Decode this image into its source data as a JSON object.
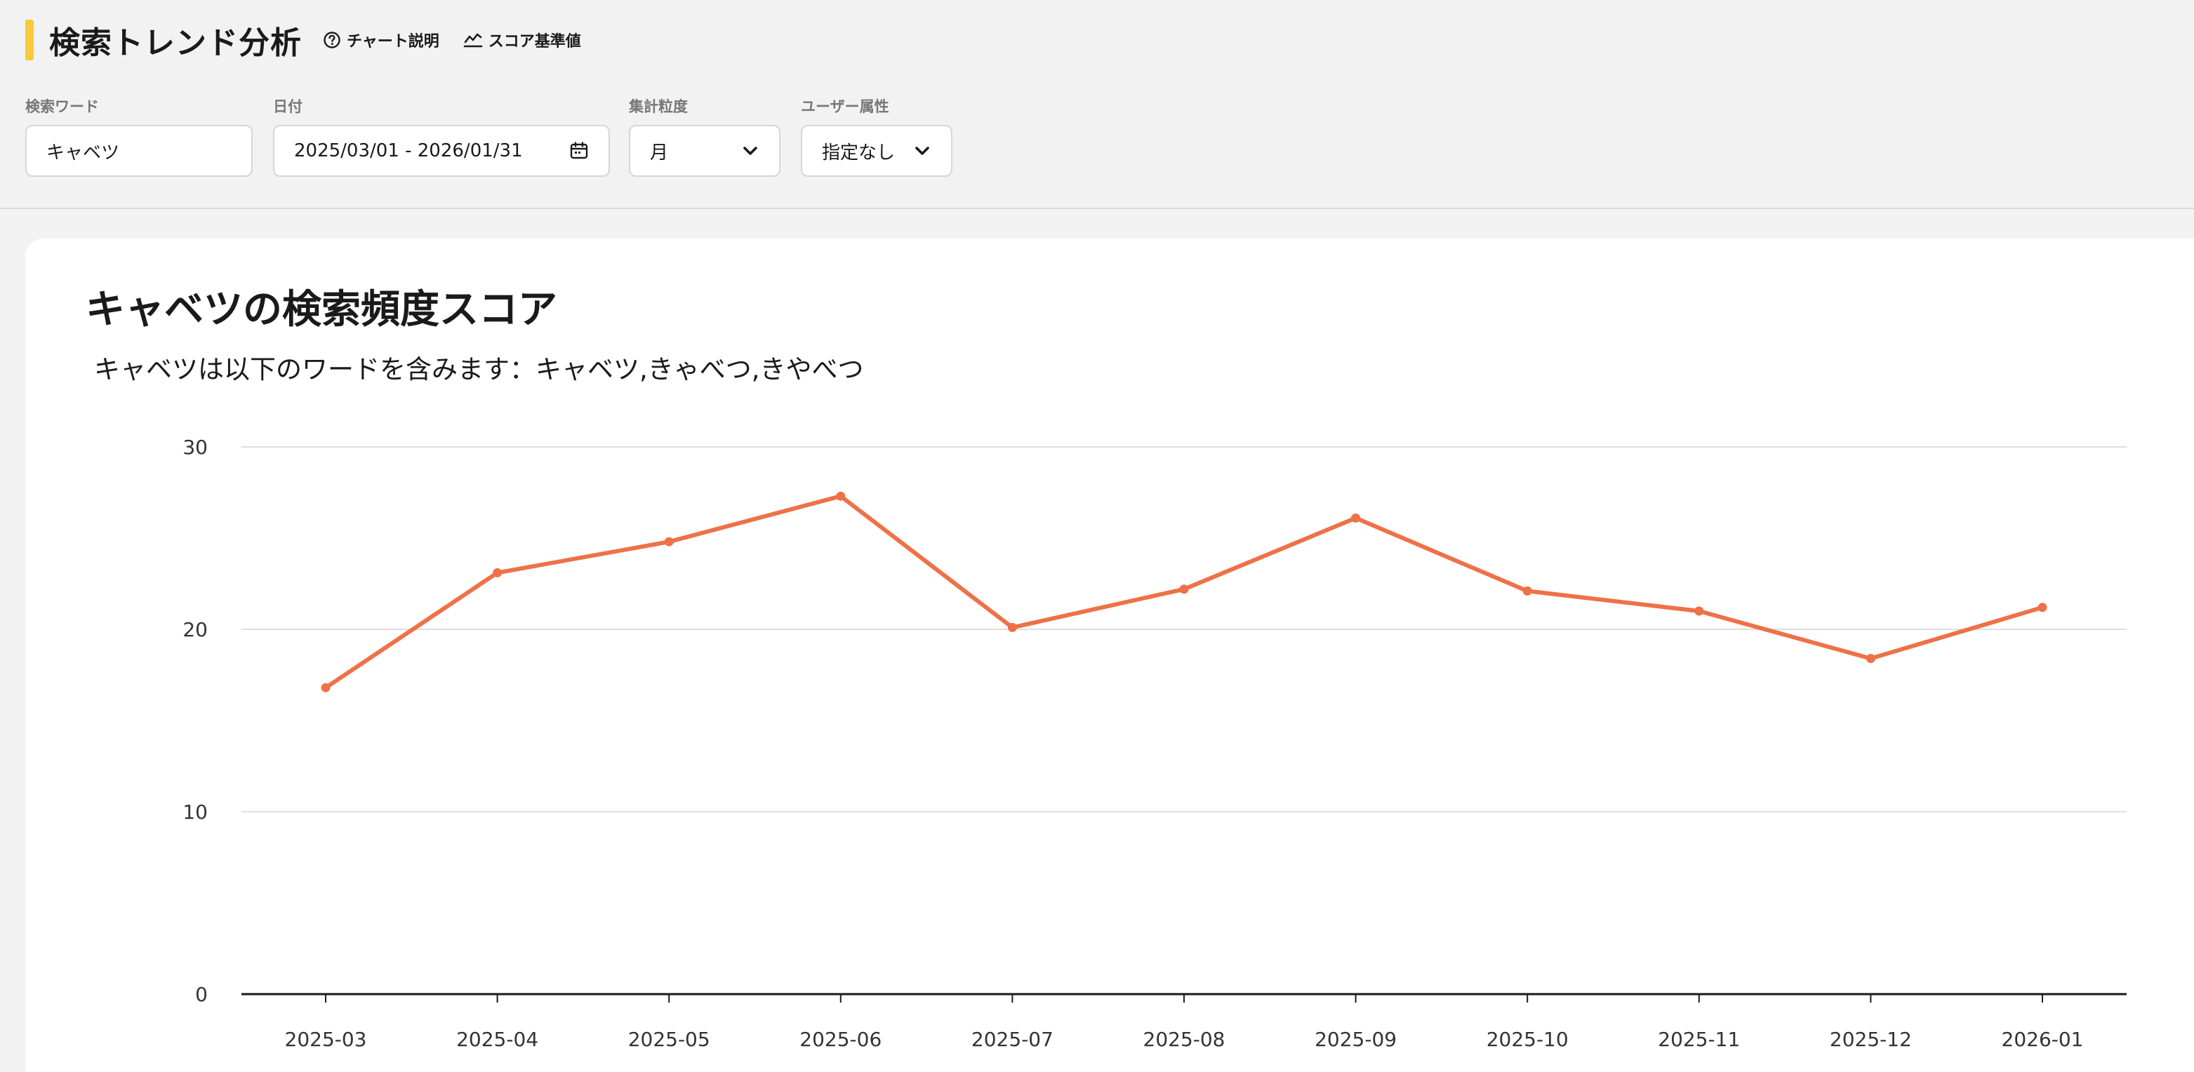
{
  "app": {
    "title": "検索トレンド分析",
    "links": [
      {
        "label": "チャート説明",
        "icon": "question-circle-icon"
      },
      {
        "label": "スコア基準値",
        "icon": "line-chart-icon"
      }
    ],
    "accent_color": "#f8c93a"
  },
  "filters": {
    "keyword": {
      "label": "検索ワード",
      "value": "キャベツ"
    },
    "date": {
      "label": "日付",
      "value": "2025/03/01 - 2026/01/31",
      "icon": "calendar-icon"
    },
    "granularity": {
      "label": "集計粒度",
      "value": "月",
      "icon": "chevron-down-icon"
    },
    "user_attr": {
      "label": "ユーザー属性",
      "value": "指定なし",
      "icon": "chevron-down-icon"
    }
  },
  "chart_data": {
    "type": "line",
    "title": "キャベツの検索頻度スコア",
    "subtitle": "キャベツは以下のワードを含みます：キャベツ,きゃべつ,きやべつ",
    "categories": [
      "2025-03",
      "2025-04",
      "2025-05",
      "2025-06",
      "2025-07",
      "2025-08",
      "2025-09",
      "2025-10",
      "2025-11",
      "2025-12",
      "2026-01"
    ],
    "series": [
      {
        "color": "#ee7148",
        "values": [
          16.8,
          23.1,
          24.8,
          27.3,
          20.1,
          22.2,
          26.1,
          22.1,
          21.0,
          18.4,
          21.2
        ]
      }
    ],
    "yticks": [
      0,
      10,
      20,
      30
    ],
    "ylim": [
      0,
      30
    ],
    "grid": true
  }
}
